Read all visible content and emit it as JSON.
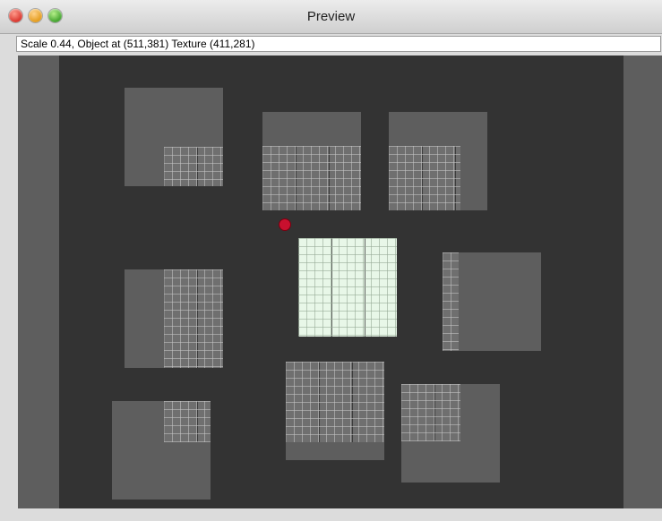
{
  "window": {
    "title": "Preview"
  },
  "status_bar": {
    "text": "Scale 0.44, Object at (511,381) Texture (411,281)"
  },
  "colors": {
    "canvas_background": "#333333",
    "object_fill": "#5e5e5e",
    "texture_tile": "#6f6f6f",
    "selected_texture": "#e8f7e8",
    "anchor_marker": "#c8102e"
  }
}
